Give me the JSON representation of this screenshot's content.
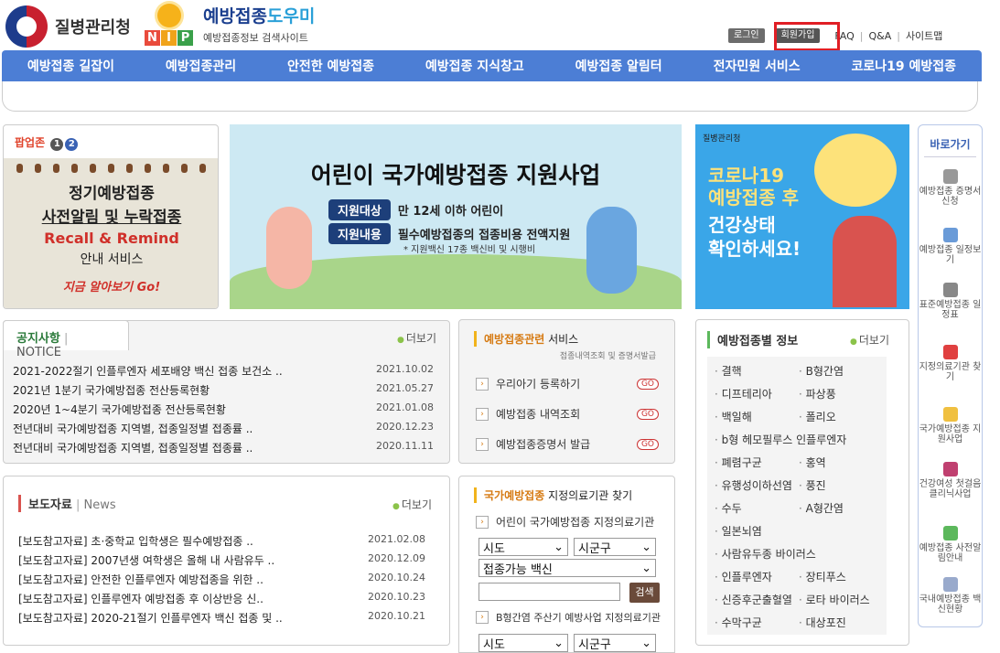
{
  "header": {
    "kdca_name": "질병관리청",
    "nip_letters": [
      "N",
      "I",
      "P"
    ],
    "site_title_a": "예방접종",
    "site_title_b": "도우미",
    "site_subtitle": "예방접종정보 검색사이트",
    "login": "로그인",
    "join": "회원가입",
    "faq": "FAQ",
    "qna": "Q&A",
    "sitemap": "사이트맵"
  },
  "nav": [
    "예방접종 길잡이",
    "예방접종관리",
    "안전한 예방접종",
    "예방접종 지식창고",
    "예방접종 알림터",
    "전자민원 서비스",
    "코로나19 예방접종"
  ],
  "popup": {
    "title": "팝업존",
    "pages": [
      "1",
      "2"
    ],
    "line1": "정기예방접종",
    "line2": "사전알림 및 누락접종",
    "line3": "Recall & Remind",
    "line4": "안내 서비스",
    "line5": "지금 알아보기 Go!"
  },
  "banner1": {
    "title": "어린이 국가예방접종 지원사업",
    "tag1": "지원대상",
    "text1": "만 12세 이하 어린이",
    "tag2": "지원내용",
    "text2": "필수예방접종의 접종비용 전액지원",
    "note": "* 지원백신 17종 백신비 및 시행비"
  },
  "banner2": {
    "logo": "질병관리청",
    "line1": "코로나19",
    "line2": "예방접종 후",
    "line3": "건강상태",
    "line4": "확인하세요!"
  },
  "quick": {
    "title": "바로가기",
    "items": [
      "예방접종 증명서 신청",
      "예방접종 일정보기",
      "표준예방접종 일정표",
      "지정의료기관 찾기",
      "국가예방접종 지원사업",
      "건강여성 첫걸음 클리닉사업",
      "예방접종 사전알림안내",
      "국내예방접종 백신현황"
    ]
  },
  "notice": {
    "title": "공지사항",
    "title_en": "NOTICE",
    "more": "더보기",
    "rows": [
      {
        "text": "2021-2022절기 인플루엔자 세포배양 백신 접종 보건소 ..",
        "date": "2021.10.02"
      },
      {
        "text": "2021년 1분기 국가예방접종 전산등록현황",
        "date": "2021.05.27"
      },
      {
        "text": "2020년 1~4분기 국가예방접종 전산등록현황",
        "date": "2021.01.08"
      },
      {
        "text": "전년대비 국가예방접종 지역별, 접종일정별 접종률 ..",
        "date": "2020.12.23"
      },
      {
        "text": "전년대비 국가예방접종 지역별, 접종일정별 접종률 ..",
        "date": "2020.11.11"
      }
    ]
  },
  "press": {
    "title": "보도자료",
    "title_en": "News",
    "more": "더보기",
    "rows": [
      {
        "text": "[보도참고자료] 초·중학교 입학생은 필수예방접종 ..",
        "date": "2021.02.08"
      },
      {
        "text": "[보도참고자료] 2007년생 여학생은 올해 내 사람유두 ..",
        "date": "2020.12.09"
      },
      {
        "text": "[보도참고자료] 안전한 인플루엔자 예방접종을 위한 ..",
        "date": "2020.10.24"
      },
      {
        "text": "[보도참고자료] 인플루엔자 예방접종 후 이상반응 신..",
        "date": "2020.10.23"
      },
      {
        "text": "[보도참고자료] 2020-21절기 인플루엔자 백신 접종 및 ..",
        "date": "2020.10.21"
      }
    ]
  },
  "service": {
    "title_a": "예방접종관련",
    "title_b": " 서비스",
    "subtitle": "접종내역조회 및 증명서발급",
    "items": [
      "우리아기 등록하기",
      "예방접종 내역조회",
      "예방접종증명서 발급"
    ],
    "go": "GO"
  },
  "clinic": {
    "title_a": "국가예방접종",
    "title_b": " 지정의료기관 찾기",
    "sub1": "어린이 국가예방접종 지정의료기관",
    "sido": "시도",
    "sigungu": "시군구",
    "vaccine": "접종가능 백신",
    "search": "검색",
    "sub2": "B형간염 주산기 예방사업 지정의료기관"
  },
  "vaccine_info": {
    "title": "예방접종별 정보",
    "more": "더보기",
    "items": [
      "결핵",
      "B형간염",
      "디프테리아",
      "파상풍",
      "백일해",
      "폴리오",
      "b형 헤모필루스 인플루엔자",
      "폐렴구균",
      "홍역",
      "유행성이하선염",
      "풍진",
      "수두",
      "A형간염",
      "일본뇌염",
      "사람유두종 바이러스",
      "인플루엔자",
      "장티푸스",
      "신증후군출혈열",
      "로타 바이러스",
      "수막구균",
      "대상포진"
    ]
  },
  "colors": {
    "nav": "#4c7ed5",
    "highlight": "#e01e25",
    "accent": "#f1b31c"
  }
}
